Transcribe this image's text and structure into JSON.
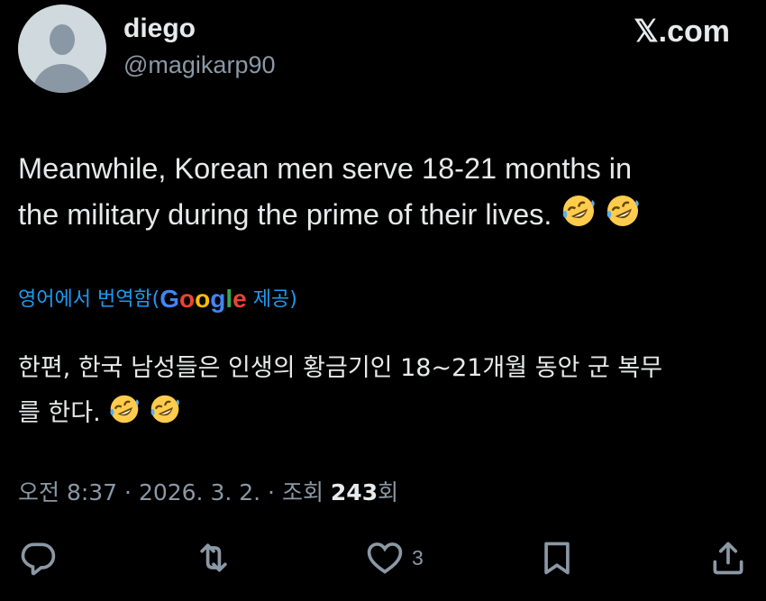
{
  "author": {
    "display_name": "diego",
    "handle": "@magikarp90"
  },
  "site_logo": "𝕏.com",
  "tweet": {
    "text_line1": "Meanwhile, Korean men serve 18-21 months in",
    "text_line2": "the military during the prime of their lives.",
    "emoji": "rolling-on-floor-laughing",
    "emoji_count": 2
  },
  "translation": {
    "prefix": "영어에서 번역함(",
    "google": [
      "G",
      "o",
      "o",
      "g",
      "l",
      "e"
    ],
    "suffix": " 제공)",
    "text_line1": "한편, 한국 남성들은 인생의 황금기인 18~21개월 동안 군 복무",
    "text_line2": "를 한다."
  },
  "meta": {
    "time": "오전 8:37",
    "sep": " · ",
    "date": "2026. 3. 2.",
    "views_prefix": "조회 ",
    "views_count": "243",
    "views_suffix": "회"
  },
  "actions": {
    "reply_icon": "reply-icon",
    "repost_icon": "repost-icon",
    "like_icon": "heart-icon",
    "like_count": "3",
    "bookmark_icon": "bookmark-icon",
    "share_icon": "share-icon"
  },
  "colors": {
    "background": "#000000",
    "text": "#e7e9ea",
    "secondary": "#8b98a5",
    "link": "#1d9bf0"
  }
}
